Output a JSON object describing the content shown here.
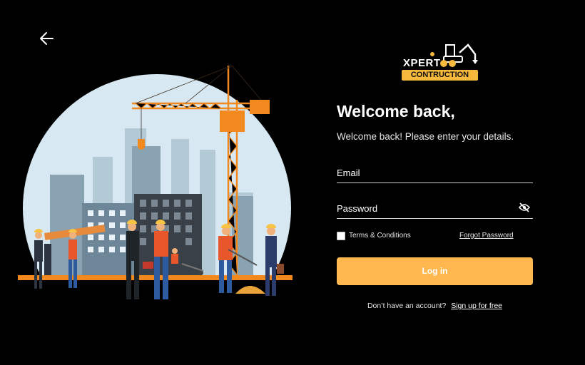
{
  "brand": {
    "name": "XPERT",
    "sub": "CONTRUCTION"
  },
  "header": {
    "back_icon": "arrow-left-icon"
  },
  "login": {
    "title": "Welcome back,",
    "subtitle": "Welcome back! Please enter your details.",
    "email_label": "Email",
    "password_label": "Password",
    "password_toggle_icon": "eye-off-icon",
    "terms_label": "Terms & Conditions",
    "forgot_label": "Forgot Password",
    "login_label": "Log in",
    "signup_prompt": "Don’t have an account?",
    "signup_link": "Sign up for free"
  },
  "colors": {
    "accent": "#ffb84f",
    "background": "#000000",
    "logo_yellow": "#f6b93b"
  }
}
